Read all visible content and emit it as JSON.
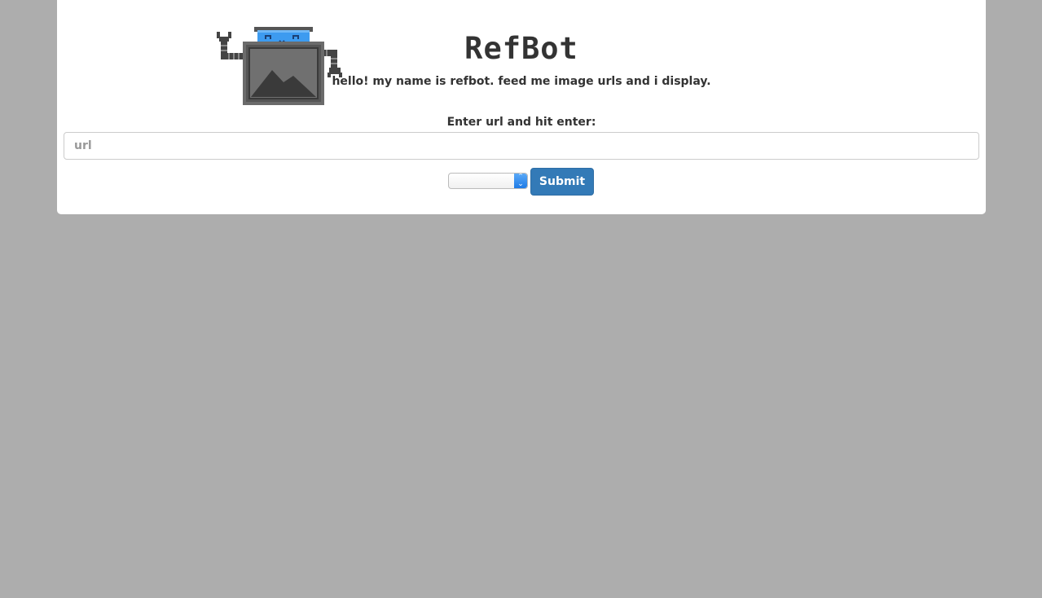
{
  "header": {
    "title": "RefBot",
    "tagline": "hello! my name is refbot. feed me image urls and i display."
  },
  "form": {
    "label": "Enter url and hit enter:",
    "url_placeholder": "url",
    "url_value": "",
    "select_value": "",
    "submit_label": "Submit"
  },
  "icons": {
    "logo": "robot-mascot-icon",
    "select_arrow": "chevron-up-down-icon"
  },
  "colors": {
    "page_background": "#adadad",
    "card_background": "#ffffff",
    "accent": "#337ab7",
    "robot_visor": "#3d9bf0",
    "robot_body": "#6b6b6b",
    "text": "#333333"
  }
}
